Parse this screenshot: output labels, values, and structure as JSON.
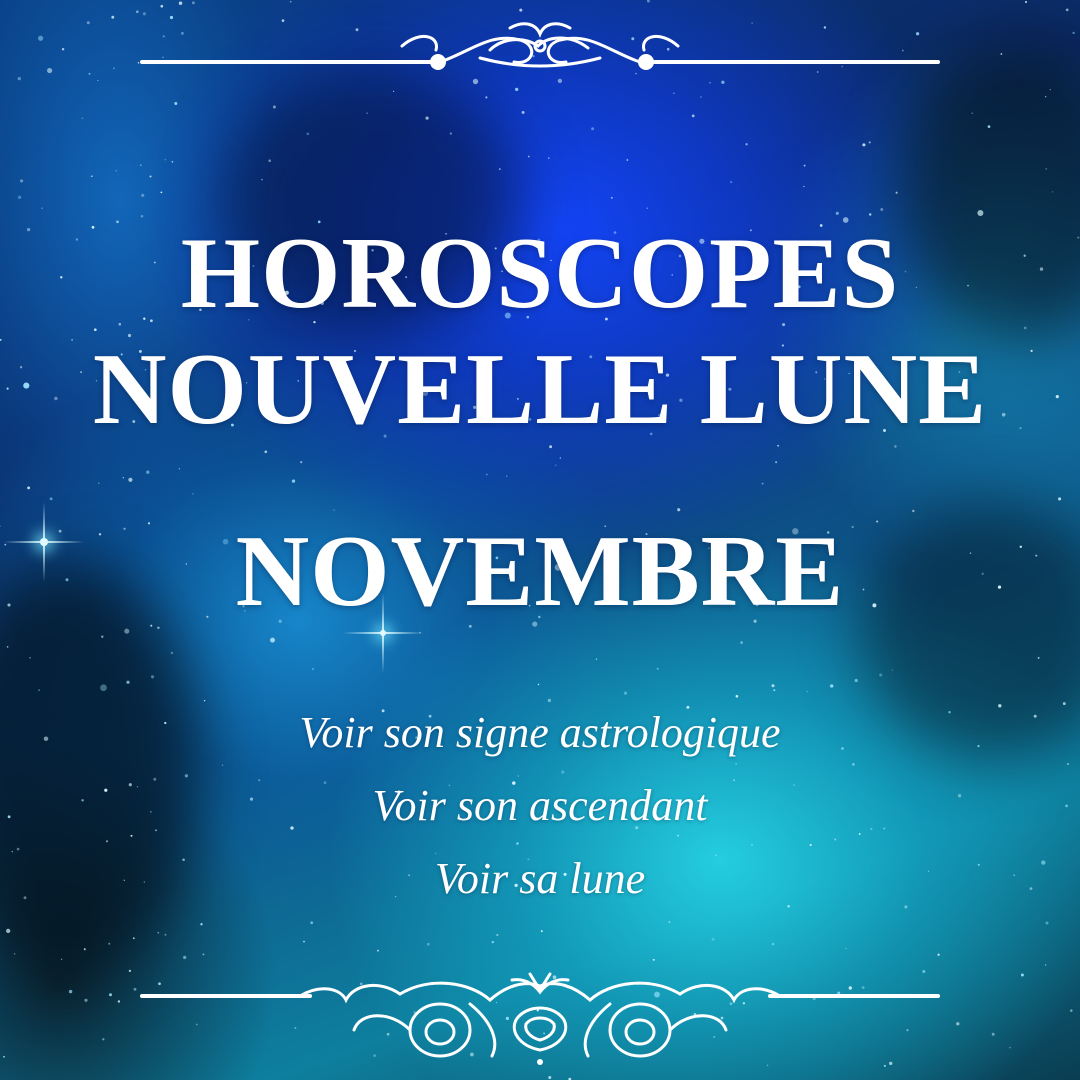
{
  "poster": {
    "title_lines": [
      "HOROSCOPES",
      "NOUVELLE LUNE",
      "NOVEMBRE"
    ],
    "links": [
      "Voir son signe astrologique",
      "Voir son ascendant",
      "Voir sa lune"
    ],
    "text_color": "#ffffff",
    "accent_colors": {
      "deep_blue": "#1446ff",
      "cyan": "#28dceb",
      "night": "#05101a"
    },
    "ornaments": [
      "ornament-top-icon",
      "ornament-bottom-icon"
    ],
    "background": "starry-nebula"
  }
}
